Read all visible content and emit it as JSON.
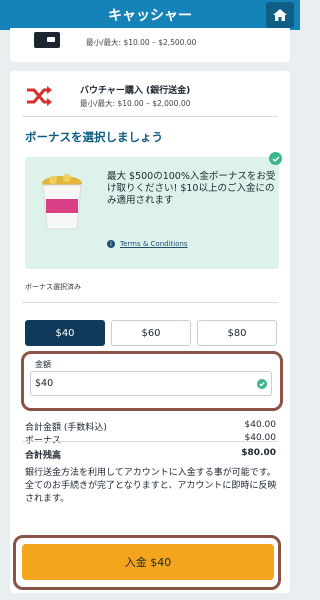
{
  "header": {
    "title": "キャッシャー"
  },
  "top_method": {
    "limits": "最小/最大: $10.00 – $2,500.00"
  },
  "method": {
    "title": "バウチャー購入 (銀行送金)",
    "limits": "最小/最大: $10.00 – $2,000.00"
  },
  "bonus": {
    "heading": "ボーナスを選択しましょう",
    "text": "最大 $500の100%入金ボーナスをお受け取りください! $10以上のご入金にのみ適用されます",
    "terms": "Terms & Conditions",
    "selected_label": "ボーナス選択済み"
  },
  "amounts": {
    "options": [
      "$40",
      "$60",
      "$80"
    ],
    "label": "金額",
    "value": "$40"
  },
  "summary": {
    "total_label": "合計金額 (手数料込)",
    "total_value": "$40.00",
    "bonus_label": "ボーナス",
    "bonus_value": "$40.00",
    "balance_label": "合計残高",
    "balance_value": "$80.00"
  },
  "note": "銀行送金方法を利用してアカウントに入金する事が可能です。全てのお手続きが完了となりますと、アカウントに即時に反映されます。",
  "deposit_button": "入金 $40",
  "colors": {
    "header": "#1683b8",
    "accent_button": "#f4a51e",
    "selected_amount": "#0f3a5c",
    "bonus_bg": "#ddf2ea",
    "highlight_outline": "#8a5347"
  },
  "icons": [
    "home-icon",
    "bank-card-icon",
    "shuffle-icon",
    "check-icon",
    "info-icon"
  ]
}
